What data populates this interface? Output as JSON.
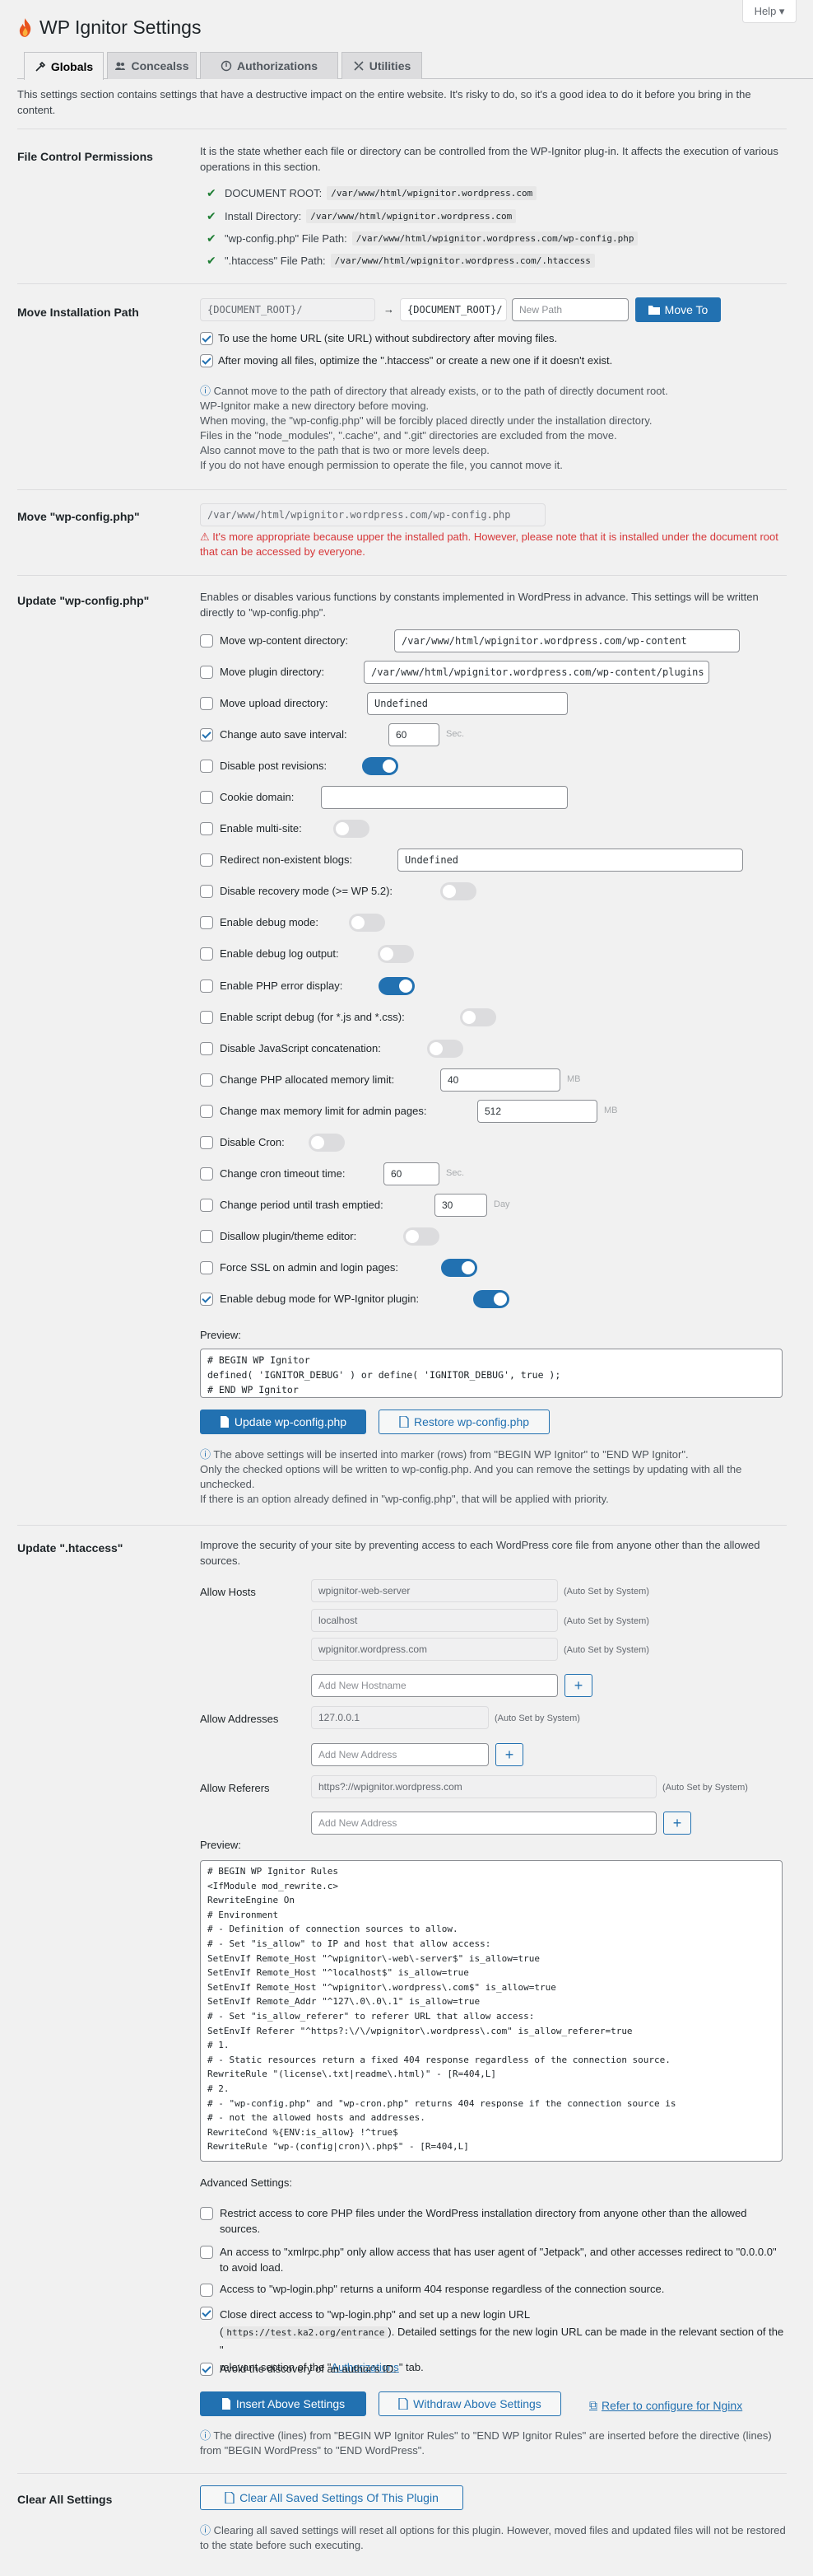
{
  "help": "Help ▾",
  "title": "WP Ignitor Settings",
  "tabs": [
    "Globals",
    "Concealss",
    "Authorizations",
    "Utilities"
  ],
  "intro": "This settings section contains settings that have a destructive impact on the entire website. It's risky to do, so it's a good idea to do it before you bring in the content.",
  "fcp": {
    "label": "File Control Permissions",
    "desc": "It is the state whether each file or directory can be controlled from the WP-Ignitor plug-in. It affects the execution of various operations in this section.",
    "rows": [
      {
        "label": "DOCUMENT ROOT:",
        "path": "/var/www/html/wpignitor.wordpress.com"
      },
      {
        "label": "Install Directory:",
        "path": "/var/www/html/wpignitor.wordpress.com"
      },
      {
        "label": "\"wp-config.php\" File Path:",
        "path": "/var/www/html/wpignitor.wordpress.com/wp-config.php"
      },
      {
        "label": "\".htaccess\" File Path:",
        "path": "/var/www/html/wpignitor.wordpress.com/.htaccess"
      }
    ]
  },
  "mip": {
    "label": "Move Installation Path",
    "root": "{DOCUMENT_ROOT}/",
    "arrow": "→",
    "root2": "{DOCUMENT_ROOT}/",
    "new_path_ph": "New Path",
    "move_btn": "Move To",
    "opt1": "To use the home URL (site URL) without subdirectory after moving files.",
    "opt2": "After moving all files, optimize the \".htaccess\" or create a new one if it doesn't exist.",
    "notes": [
      "Cannot move to the path of directory that already exists, or to the path of directly document root.",
      "WP-Ignitor make a new directory before moving.",
      "When moving, the \"wp-config.php\" will be forcibly placed directly under the installation directory.",
      "Files in the \"node_modules\", \".cache\", and \".git\" directories are excluded from the move.",
      "Also cannot move to the path that is two or more levels deep.",
      "If you do not have enough permission to operate the file, you cannot move it."
    ]
  },
  "mwc": {
    "label": "Move \"wp-config.php\"",
    "path": "/var/www/html/wpignitor.wordpress.com/wp-config.php",
    "warn": "It's more appropriate because upper the installed path. However, please note that it is installed under the document root that can be accessed by everyone."
  },
  "uwc": {
    "label": "Update \"wp-config.php\"",
    "desc": "Enables or disables various functions by constants implemented in WordPress in advance. This settings will be written directly to \"wp-config.php\".",
    "items": [
      {
        "label": "Move wp-content directory:",
        "value": "/var/www/html/wpignitor.wordpress.com/wp-content"
      },
      {
        "label": "Move plugin directory:",
        "value": "/var/www/html/wpignitor.wordpress.com/wp-content/plugins"
      },
      {
        "label": "Move upload directory:",
        "value": "Undefined"
      },
      {
        "label": "Change auto save interval:",
        "value": "60",
        "unit": "Sec."
      },
      {
        "label": "Disable post revisions:"
      },
      {
        "label": "Cookie domain:",
        "value": ""
      },
      {
        "label": "Enable multi-site:"
      },
      {
        "label": "Redirect non-existent blogs:",
        "value": "Undefined"
      },
      {
        "label": "Disable recovery mode (>= WP 5.2):"
      },
      {
        "label": "Enable debug mode:"
      },
      {
        "label": "Enable debug log output:"
      },
      {
        "label": "Enable PHP error display:"
      },
      {
        "label": "Enable script debug (for *.js and *.css):"
      },
      {
        "label": "Disable JavaScript concatenation:"
      },
      {
        "label": "Change PHP allocated memory limit:",
        "value": "40",
        "unit": "MB"
      },
      {
        "label": "Change max memory limit for admin pages:",
        "value": "512",
        "unit": "MB"
      },
      {
        "label": "Disable Cron:"
      },
      {
        "label": "Change cron timeout time:",
        "value": "60",
        "unit": "Sec."
      },
      {
        "label": "Change period until trash emptied:",
        "value": "30",
        "unit": "Day"
      },
      {
        "label": "Disallow plugin/theme editor:"
      },
      {
        "label": "Force SSL on admin and login pages:"
      },
      {
        "label": "Enable debug mode for WP-Ignitor plugin:"
      }
    ],
    "preview_label": "Preview:",
    "preview": "# BEGIN WP Ignitor\ndefined( 'IGNITOR_DEBUG' ) or define( 'IGNITOR_DEBUG', true );\n# END WP Ignitor",
    "update_btn": "Update wp-config.php",
    "restore_btn": "Restore wp-config.php",
    "notes": [
      "The above settings will be inserted into marker (rows) from \"BEGIN WP Ignitor\" to \"END WP Ignitor\".",
      "Only the checked options will be written to wp-config.php. And you can remove the settings by updating with all the unchecked.",
      "If there is an option already defined in \"wp-config.php\", that will be applied with priority."
    ]
  },
  "uht": {
    "label": "Update \".htaccess\"",
    "desc": "Improve the security of your site by preventing access to each WordPress core file from anyone other than the allowed sources.",
    "hosts_label": "Allow Hosts",
    "hosts": [
      "wpignitor-web-server",
      "localhost",
      "wpignitor.wordpress.com"
    ],
    "auto": "(Auto Set by System)",
    "host_ph": "Add New Hostname",
    "addr_label": "Allow Addresses",
    "addrs": [
      "127.0.0.1"
    ],
    "addr_ph": "Add New Address",
    "ref_label": "Allow Referers",
    "refs": [
      "https?://wpignitor.wordpress.com"
    ],
    "ref_ph": "Add New Address",
    "preview_label": "Preview:",
    "preview": "# BEGIN WP Ignitor Rules\n<IfModule mod_rewrite.c>\nRewriteEngine On\n# Environment\n# - Definition of connection sources to allow.\n# - Set \"is_allow\" to IP and host that allow access:\nSetEnvIf Remote_Host \"^wpignitor\\-web\\-server$\" is_allow=true\nSetEnvIf Remote_Host \"^localhost$\" is_allow=true\nSetEnvIf Remote_Host \"^wpignitor\\.wordpress\\.com$\" is_allow=true\nSetEnvIf Remote_Addr \"^127\\.0\\.0\\.1\" is_allow=true\n# - Set \"is_allow_referer\" to referer URL that allow access:\nSetEnvIf Referer \"^https?:\\/\\/wpignitor\\.wordpress\\.com\" is_allow_referer=true\n# 1.\n# - Static resources return a fixed 404 response regardless of the connection source.\nRewriteRule \"(license\\.txt|readme\\.html)\" - [R=404,L]\n# 2.\n# - \"wp-config.php\" and \"wp-cron.php\" returns 404 response if the connection source is\n# - not the allowed hosts and addresses.\nRewriteCond %{ENV:is_allow} !^true$\nRewriteRule \"wp-(config|cron)\\.php$\" - [R=404,L]",
    "adv_label": "Advanced Settings:",
    "adv": [
      "Restrict access to core PHP files under the WordPress installation directory from anyone other than the allowed sources.",
      "An access to \"xmlrpc.php\" only allow access that has user agent of \"Jetpack\", and other accesses redirect to \"0.0.0.0\" to avoid load.",
      "Access to \"wp-login.php\" returns a uniform 404 response regardless of the connection source.",
      "Close direct access to \"wp-login.php\" and set up a new login URL",
      "Avoid the discovery of an author's ID."
    ],
    "login_url": "https://test.ka2.org/entrance",
    "login_tail": ". Detailed settings for the new login URL can be made in the relevant section of the \"",
    "auth_link": "Authorizations",
    "login_end": "\" tab.",
    "insert_btn": "Insert Above Settings",
    "withdraw_btn": "Withdraw Above Settings",
    "nginx_link": "Refer to configure for Nginx",
    "note": "The directive (lines) from \"BEGIN WP Ignitor Rules\" to \"END WP Ignitor Rules\" are inserted before the directive (lines) from \"BEGIN WordPress\" to \"END WordPress\"."
  },
  "clear": {
    "label": "Clear All Settings",
    "btn": "Clear All Saved Settings Of This Plugin",
    "note": "Clearing all saved settings will reset all options for this plugin. However, moved files and updated files will not be restored to the state before such executing."
  }
}
